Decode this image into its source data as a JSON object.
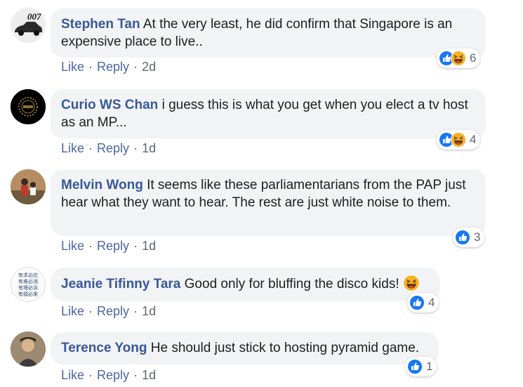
{
  "comments": [
    {
      "name": "Stephen Tan",
      "text": "At the very least, he did confirm that Singapore is an expensive place to live..",
      "actions": {
        "like": "Like",
        "reply": "Reply",
        "time": "2d",
        "sep": "·"
      },
      "reactions": {
        "types": [
          "like-icon",
          "haha-icon"
        ],
        "count": "6"
      },
      "avatar_text": "007"
    },
    {
      "name": "Curio WS Chan",
      "text": "i guess this is what you get when you elect a tv host as an MP...",
      "actions": {
        "like": "Like",
        "reply": "Reply",
        "time": "1d",
        "sep": "·"
      },
      "reactions": {
        "types": [
          "like-icon",
          "haha-icon"
        ],
        "count": "4"
      }
    },
    {
      "name": "Melvin Wong",
      "text": "It seems like these parliamentarians from the PAP just hear what they want to hear. The rest are just white noise to them.",
      "actions": {
        "like": "Like",
        "reply": "Reply",
        "time": "1d",
        "sep": "·"
      },
      "reactions": {
        "types": [
          "like-icon"
        ],
        "count": "3"
      }
    },
    {
      "name": "Jeanie Tifinny Tara",
      "text": "Good only for bluffing the disco kids!",
      "actions": {
        "like": "Like",
        "reply": "Reply",
        "time": "1d",
        "sep": "·"
      },
      "reactions": {
        "types": [
          "like-icon"
        ],
        "count": "4"
      },
      "emoji": "laughing-emoji",
      "avatar_lines": [
        "有求必应",
        "有难必消",
        "有理必诉",
        "有福必来"
      ]
    },
    {
      "name": "Terence Yong",
      "text": "He should just stick to hosting pyramid game.",
      "actions": {
        "like": "Like",
        "reply": "Reply",
        "time": "1d",
        "sep": "·"
      },
      "reactions": {
        "types": [
          "like-icon"
        ],
        "count": "1"
      }
    }
  ],
  "colors": {
    "name": "#385898",
    "link": "#4b67a1",
    "bubble": "#f2f3f5",
    "like": "#1877f2",
    "haha": "#f7b125"
  }
}
